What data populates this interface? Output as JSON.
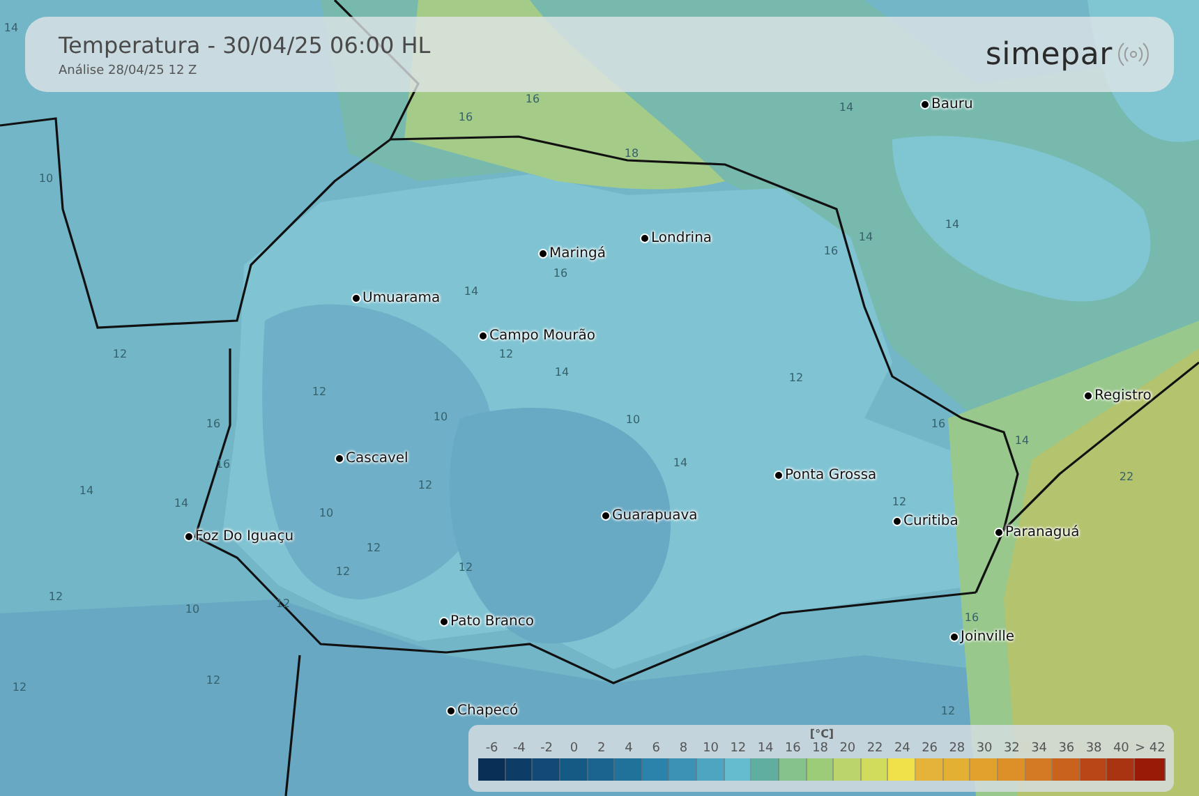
{
  "header": {
    "title": "Temperatura - 30/04/25 06:00 HL",
    "subtitle": "Análise 28/04/25 12 Z",
    "brand": "simepar"
  },
  "cities": [
    "Bauru",
    "Londrina",
    "Maringá",
    "Umuarama",
    "Campo Mourão",
    "Registro",
    "Cascavel",
    "Ponta Grossa",
    "Guarapuava",
    "Curitiba",
    "Paranaguá",
    "Foz Do Iguaçu",
    "Pato Branco",
    "Joinville",
    "Chapecó"
  ],
  "contour_labels": [
    "14",
    "16",
    "16",
    "14",
    "10",
    "18",
    "14",
    "14",
    "16",
    "16",
    "14",
    "12",
    "12",
    "14",
    "12",
    "12",
    "16",
    "10",
    "10",
    "16",
    "16",
    "14",
    "14",
    "12",
    "14",
    "22",
    "14",
    "12",
    "10",
    "12",
    "12",
    "12",
    "12",
    "10",
    "12",
    "16",
    "12",
    "12",
    "12"
  ],
  "legend": {
    "unit": "[°C]",
    "items": [
      {
        "label": "-6",
        "color": "#0a2f57"
      },
      {
        "label": "-4",
        "color": "#0d3d66"
      },
      {
        "label": "-2",
        "color": "#114b75"
      },
      {
        "label": "0",
        "color": "#155a85"
      },
      {
        "label": "2",
        "color": "#1a6590"
      },
      {
        "label": "4",
        "color": "#21729b"
      },
      {
        "label": "6",
        "color": "#2b82ab"
      },
      {
        "label": "8",
        "color": "#3b92b4"
      },
      {
        "label": "10",
        "color": "#4ea5c2"
      },
      {
        "label": "12",
        "color": "#66bccf"
      },
      {
        "label": "14",
        "color": "#5fae9f"
      },
      {
        "label": "16",
        "color": "#86c28b"
      },
      {
        "label": "18",
        "color": "#9ccc78"
      },
      {
        "label": "20",
        "color": "#bbd56c"
      },
      {
        "label": "22",
        "color": "#d2dc5c"
      },
      {
        "label": "24",
        "color": "#f0e04a"
      },
      {
        "label": "26",
        "color": "#e5b33a"
      },
      {
        "label": "28",
        "color": "#e4b034"
      },
      {
        "label": "30",
        "color": "#e2a12c"
      },
      {
        "label": "32",
        "color": "#dd8f28"
      },
      {
        "label": "34",
        "color": "#d47a22"
      },
      {
        "label": "36",
        "color": "#c9621c"
      },
      {
        "label": "38",
        "color": "#b94616"
      },
      {
        "label": "40",
        "color": "#a93412"
      },
      {
        "label": "> 42",
        "color": "#9a1a08"
      }
    ]
  }
}
